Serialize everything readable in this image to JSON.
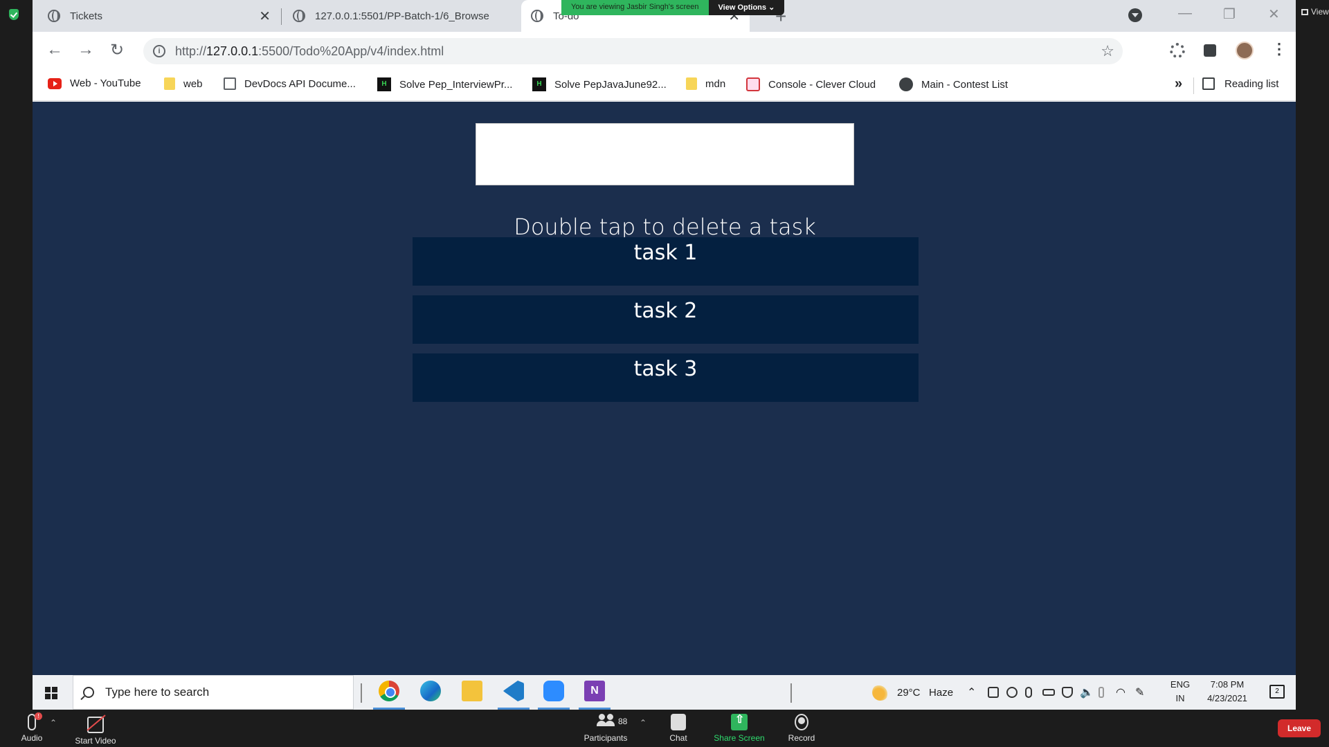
{
  "zoom": {
    "share_notice": "You are viewing Jasbir Singh's screen",
    "view_options": "View Options",
    "view_button": "View",
    "controls": {
      "audio": "Audio",
      "audio_badge": "!",
      "start_video": "Start Video",
      "participants": "Participants",
      "participant_count": "88",
      "chat": "Chat",
      "share_screen": "Share Screen",
      "record": "Record",
      "leave": "Leave"
    }
  },
  "browser": {
    "tabs": [
      {
        "title": "Tickets",
        "close": "✕"
      },
      {
        "title": "127.0.0.1:5501/PP-Batch-1/6_Browse",
        "close": "✕"
      },
      {
        "title": "To-do",
        "close": "✕"
      }
    ],
    "new_tab": "+",
    "url_prefix": "http://",
    "url_host": "127.0.0.1",
    "url_rest": ":5500/Todo%20App/v4/index.html",
    "bookmarks": [
      {
        "label": "Web - YouTube",
        "icon": "youtube-icon"
      },
      {
        "label": "web",
        "icon": "folder-icon"
      },
      {
        "label": "DevDocs API Docume...",
        "icon": "devdocs-icon"
      },
      {
        "label": "Solve Pep_InterviewPr...",
        "icon": "hackerrank-icon"
      },
      {
        "label": "Solve PepJavaJune92...",
        "icon": "hackerrank-icon"
      },
      {
        "label": "mdn",
        "icon": "folder-icon"
      },
      {
        "label": "Console - Clever Cloud",
        "icon": "clever-cloud-icon"
      },
      {
        "label": "Main - Contest List",
        "icon": "globe-icon"
      }
    ],
    "bookmarks_more": "»",
    "reading_list": "Reading list"
  },
  "page": {
    "input_value": "",
    "hint": "Double tap to delete a task",
    "tasks": [
      "task 1",
      "task 2",
      "task 3"
    ]
  },
  "taskbar": {
    "search_placeholder": "Type here to search",
    "weather_temp": "29°C",
    "weather_desc": "Haze",
    "lang": "ENG",
    "region": "IN",
    "time": "7:08 PM",
    "date": "4/23/2021",
    "notification_count": "2"
  }
}
